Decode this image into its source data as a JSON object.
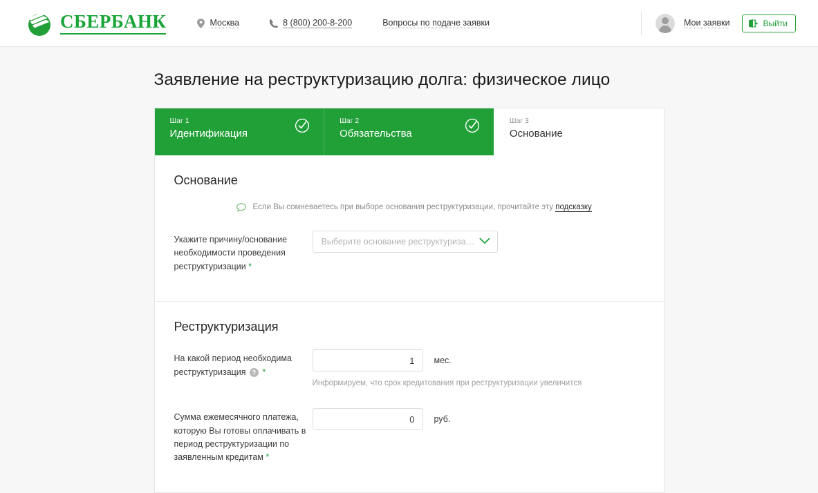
{
  "brand": {
    "name": "СБЕРБАНК",
    "logo_icon": "sberbank-logo-icon",
    "accent_color": "#21a038"
  },
  "header": {
    "city": "Москва",
    "city_icon": "location-pin-icon",
    "phone": "8 (800) 200-8-200",
    "phone_icon": "phone-icon",
    "faq_link": "Вопросы по подаче заявки",
    "my_applications": "Мои заявки",
    "avatar_icon": "user-avatar-icon",
    "logout_label": "Выйти",
    "logout_icon": "exit-icon"
  },
  "page": {
    "title": "Заявление на реструктуризацию долга: физическое лицо"
  },
  "steps": [
    {
      "num": "Шаг 1",
      "name": "Идентификация",
      "state": "done",
      "check_icon": "check-circle-icon"
    },
    {
      "num": "Шаг 2",
      "name": "Обязательства",
      "state": "done",
      "check_icon": "check-circle-icon"
    },
    {
      "num": "Шаг 3",
      "name": "Основание",
      "state": "current"
    }
  ],
  "reason_section": {
    "title": "Основание",
    "tip_icon": "speech-bubble-icon",
    "tip_text": "Если Вы сомневаетесь при выборе основания реструктуризации, прочитайте эту ",
    "tip_link": "подсказку",
    "field_label": "Укажите причину/основание необходимости проведения реструктуризации",
    "required_mark": "*",
    "select_placeholder": "Выберите основание реструктуризации...",
    "select_value": "",
    "chevron_icon": "chevron-down-icon"
  },
  "restructuring_section": {
    "title": "Реструктуризация",
    "period": {
      "label": "На какой период необходима реструктуризация",
      "help_icon": "question-mark-icon",
      "required_mark": "*",
      "value": "1",
      "unit": "мес.",
      "hint": "Информируем, что срок кредитования при реструктуризации увеличится"
    },
    "payment": {
      "label": "Сумма ежемесячного платежа, которую Вы готовы оплачивать в период реструктуризации по заявленным кредитам",
      "required_mark": "*",
      "value": "0",
      "unit": "руб."
    }
  }
}
